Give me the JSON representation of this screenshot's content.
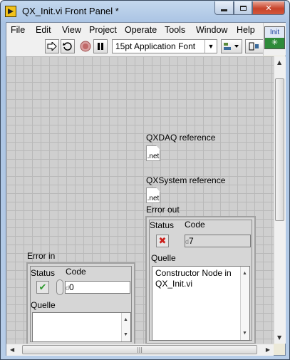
{
  "window": {
    "title": "QX_Init.vi Front Panel *",
    "close_label": "✕"
  },
  "menu": [
    {
      "label": "File"
    },
    {
      "label": "Edit"
    },
    {
      "label": "View"
    },
    {
      "label": "Project"
    },
    {
      "label": "Operate"
    },
    {
      "label": "Tools"
    },
    {
      "label": "Window"
    },
    {
      "label": "Help"
    }
  ],
  "toolbar": {
    "font_select": "15pt Application Font",
    "icons": [
      "run-arrow-icon",
      "run-continuously-icon",
      "abort-icon",
      "pause-icon",
      "align-objects-icon",
      "distribute-objects-icon"
    ]
  },
  "vi_icon": {
    "label": "Init",
    "symbol": "✳"
  },
  "controls": {
    "qxdaq_ref": {
      "label": "QXDAQ reference",
      "icon_text": ".net"
    },
    "qxsystem_ref": {
      "label": "QXSystem reference",
      "icon_text": ".net"
    },
    "error_out": {
      "label": "Error out",
      "status_label": "Status",
      "code_label": "Code",
      "code_value": "7",
      "code_prefix": "d",
      "status_glyph": "✖",
      "source_label": "Quelle",
      "source_value": "Constructor Node in QX_Init.vi"
    },
    "error_in": {
      "label": "Error in",
      "status_label": "Status",
      "code_label": "Code",
      "code_value": "0",
      "code_prefix": "d",
      "status_glyph": "✔",
      "source_label": "Quelle",
      "source_value": ""
    }
  },
  "colors": {
    "status_error": "#cc1f1a",
    "status_ok": "#2f9a2f"
  }
}
